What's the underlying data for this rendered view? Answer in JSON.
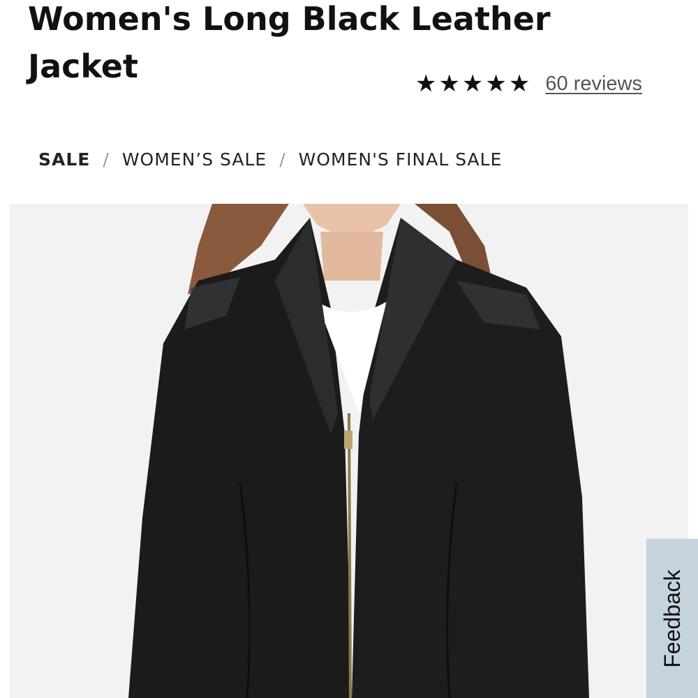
{
  "product": {
    "title": "Women's Long Black Leather Jacket"
  },
  "rating": {
    "stars": 4.8,
    "max_stars": 5,
    "reviews_label": "60 reviews"
  },
  "breadcrumb": {
    "items": [
      "SALE",
      "WOMEN’S SALE",
      "WOMEN'S FINAL SALE"
    ],
    "separator": "/"
  },
  "hero": {
    "icon": "product-photo-leather-jacket"
  },
  "feedback": {
    "label": "Feedback"
  },
  "colors": {
    "text": "#111111",
    "hero_bg": "#f2f2f2",
    "feedback_bg": "#c5d3de"
  }
}
